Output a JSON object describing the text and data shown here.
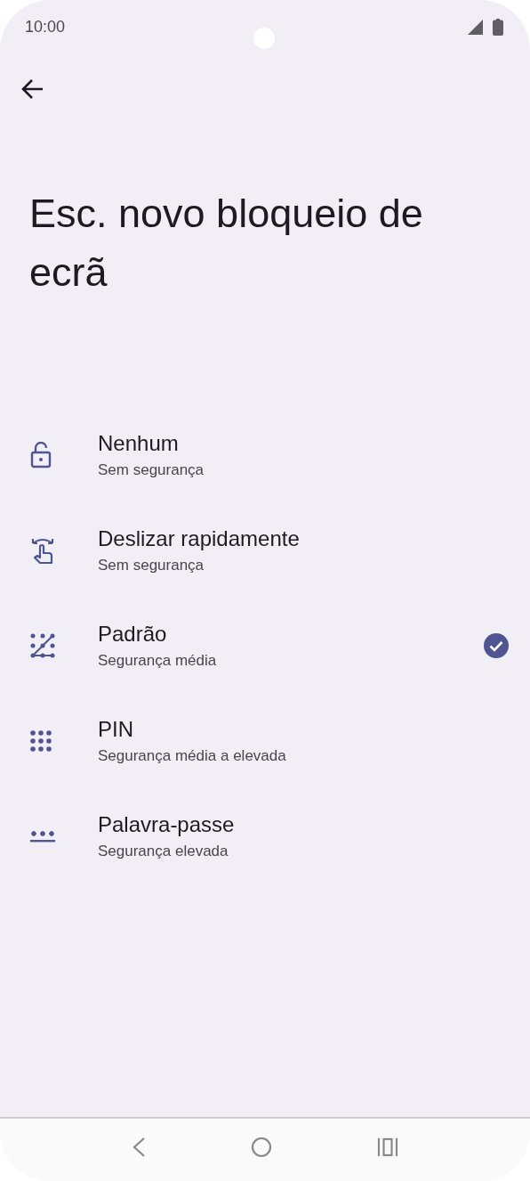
{
  "status_bar": {
    "time": "10:00"
  },
  "title": "Esc. novo bloqueio de ecrã",
  "options": [
    {
      "kind": "none",
      "label": "Nenhum",
      "description": "Sem segurança",
      "selected": false
    },
    {
      "kind": "swipe",
      "label": "Deslizar rapidamente",
      "description": "Sem segurança",
      "selected": false
    },
    {
      "kind": "pattern",
      "label": "Padrão",
      "description": "Segurança média",
      "selected": true
    },
    {
      "kind": "pin",
      "label": "PIN",
      "description": "Segurança média a elevada",
      "selected": false
    },
    {
      "kind": "password",
      "label": "Palavra-passe",
      "description": "Segurança elevada",
      "selected": false
    }
  ]
}
